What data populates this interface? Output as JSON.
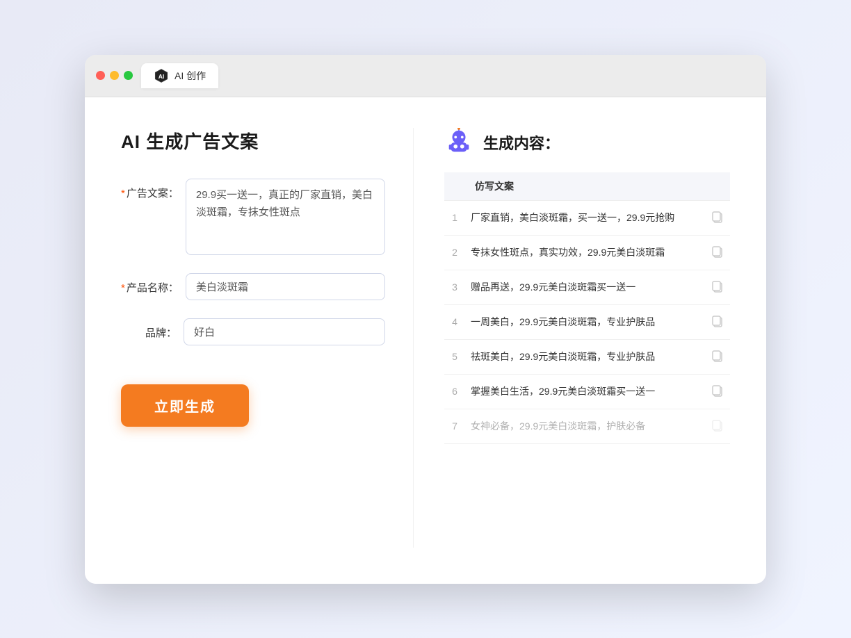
{
  "browser": {
    "tab_label": "AI 创作"
  },
  "page": {
    "title": "AI 生成广告文案",
    "right_header": "生成内容："
  },
  "form": {
    "ad_copy_label": "广告文案：",
    "ad_copy_required": true,
    "ad_copy_value": "29.9买一送一，真正的厂家直销，美白淡斑霜，专抹女性斑点",
    "product_name_label": "产品名称：",
    "product_name_required": true,
    "product_name_value": "美白淡斑霜",
    "brand_label": "品牌：",
    "brand_required": false,
    "brand_value": "好白",
    "generate_button": "立即生成"
  },
  "results": {
    "column_label": "仿写文案",
    "items": [
      {
        "num": "1",
        "text": "厂家直销，美白淡斑霜，买一送一，29.9元抢购",
        "active": true
      },
      {
        "num": "2",
        "text": "专抹女性斑点，真实功效，29.9元美白淡斑霜",
        "active": true
      },
      {
        "num": "3",
        "text": "赠品再送，29.9元美白淡斑霜买一送一",
        "active": true
      },
      {
        "num": "4",
        "text": "一周美白，29.9元美白淡斑霜，专业护肤品",
        "active": true
      },
      {
        "num": "5",
        "text": "祛斑美白，29.9元美白淡斑霜，专业护肤品",
        "active": true
      },
      {
        "num": "6",
        "text": "掌握美白生活，29.9元美白淡斑霜买一送一",
        "active": true
      },
      {
        "num": "7",
        "text": "女神必备，29.9元美白淡斑霜，护肤必备",
        "active": false
      }
    ]
  }
}
